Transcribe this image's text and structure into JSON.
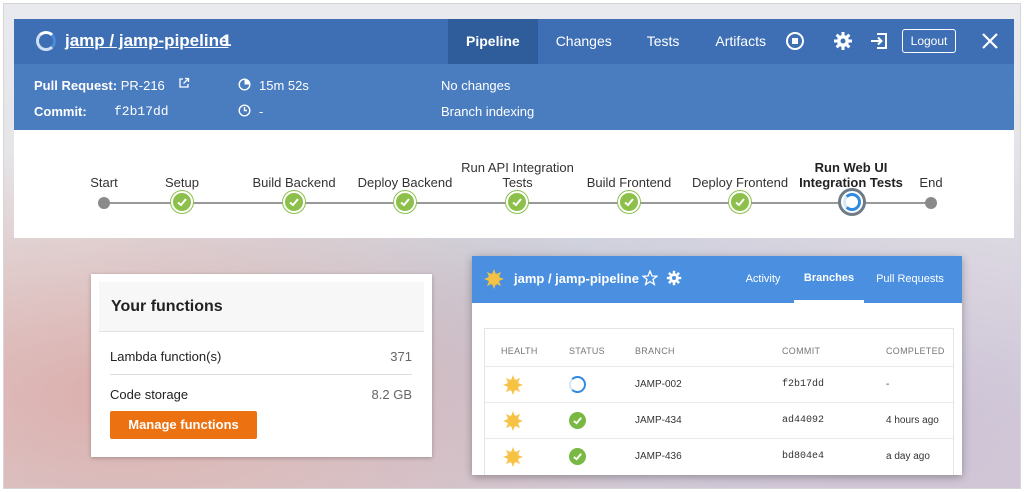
{
  "header": {
    "job_title": "jamp / jamp-pipeline",
    "run_number": "1",
    "tabs": [
      "Pipeline",
      "Changes",
      "Tests",
      "Artifacts"
    ],
    "active_tab": "Pipeline",
    "logout_label": "Logout",
    "icons": [
      "stop-icon",
      "gear-icon",
      "exit-icon",
      "close-icon"
    ]
  },
  "info": {
    "pr_label": "Pull Request:",
    "pr_value": "PR-216",
    "commit_label": "Commit:",
    "commit_value": "f2b17dd",
    "duration": "15m 52s",
    "time_ago": "-",
    "changes": "No changes",
    "cause": "Branch indexing"
  },
  "stages": [
    {
      "label": "Start",
      "state": "end"
    },
    {
      "label": "Setup",
      "state": "success"
    },
    {
      "label": "Build Backend",
      "state": "success"
    },
    {
      "label": "Deploy Backend",
      "state": "success"
    },
    {
      "label": "Run API Integration Tests",
      "state": "success"
    },
    {
      "label": "Build Frontend",
      "state": "success"
    },
    {
      "label": "Deploy Frontend",
      "state": "success"
    },
    {
      "label": "Run Web UI Integration Tests",
      "state": "running"
    },
    {
      "label": "End",
      "state": "end"
    }
  ],
  "functions_card": {
    "title": "Your functions",
    "rows": [
      {
        "label": "Lambda function(s)",
        "value": "371"
      },
      {
        "label": "Code storage",
        "value": "8.2 GB"
      }
    ],
    "button_label": "Manage functions",
    "button_color": "#ec7211"
  },
  "branches_card": {
    "title": "jamp / jamp-pipeline",
    "tabs": [
      "Activity",
      "Branches",
      "Pull Requests"
    ],
    "active_tab": "Branches",
    "columns": [
      "HEALTH",
      "STATUS",
      "BRANCH",
      "COMMIT",
      "COMPLETED"
    ],
    "rows": [
      {
        "health": "sunny-icon",
        "status": "running",
        "branch": "JAMP-002",
        "commit": "f2b17dd",
        "completed": "-"
      },
      {
        "health": "sunny-icon",
        "status": "success",
        "branch": "JAMP-434",
        "commit": "ad44092",
        "completed": "4 hours ago"
      },
      {
        "health": "sunny-icon",
        "status": "success",
        "branch": "JAMP-436",
        "commit": "bd804e4",
        "completed": "a day ago"
      }
    ]
  },
  "colors": {
    "header_blue": "#3e6fb5",
    "info_blue": "#4a7cc0",
    "success_green": "#8cc04b",
    "running_blue": "#2f8ae0",
    "branches_header": "#4a8fe0"
  }
}
